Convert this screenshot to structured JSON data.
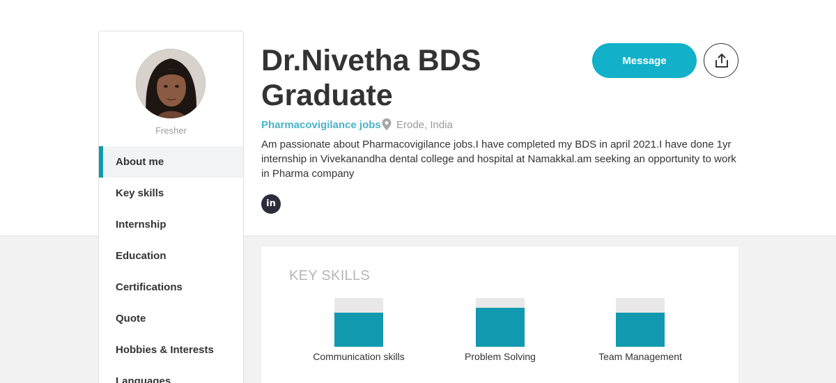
{
  "profile": {
    "name": "Dr.Nivetha BDS Graduate",
    "role_label": "Fresher",
    "job_interest": "Pharmacovigilance jobs",
    "location": "Erode, India",
    "bio": "Am passionate about Pharmacovigilance jobs.I have completed my BDS in april 2021.I have done 1yr internship in Vivekanandha dental college and hospital at Namakkal.am seeking an opportunity to work in Pharma company",
    "linkedin_glyph": "in"
  },
  "actions": {
    "message_label": "Message",
    "share_icon": "share-upload-icon"
  },
  "sidebar": {
    "items": [
      {
        "label": "About me",
        "active": true
      },
      {
        "label": "Key skills",
        "active": false
      },
      {
        "label": "Internship",
        "active": false
      },
      {
        "label": "Education",
        "active": false
      },
      {
        "label": "Certifications",
        "active": false
      },
      {
        "label": "Quote",
        "active": false
      },
      {
        "label": "Hobbies & Interests",
        "active": false
      },
      {
        "label": "Languages",
        "active": false
      }
    ]
  },
  "skills": {
    "title": "KEY SKILLS",
    "items": [
      {
        "label": "Communication skills",
        "level": 0.7
      },
      {
        "label": "Problem Solving",
        "level": 0.8
      },
      {
        "label": "Team Management",
        "level": 0.7
      }
    ]
  },
  "colors": {
    "accent": "#1199b0",
    "button": "#12b1c9",
    "link": "#4ab3c8"
  }
}
